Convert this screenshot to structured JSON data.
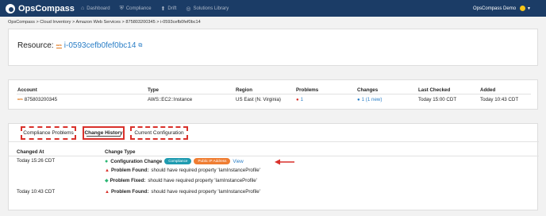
{
  "brand": "OpsCompass",
  "nav": [
    {
      "label": "Dashboard",
      "icon": "dashboard-icon",
      "glyph": "⌂"
    },
    {
      "label": "Compliance",
      "icon": "shield-icon",
      "glyph": "⛨"
    },
    {
      "label": "Drift",
      "icon": "drift-icon",
      "glyph": "⬆"
    },
    {
      "label": "Solutions Library",
      "icon": "library-icon",
      "glyph": "◎"
    }
  ],
  "user": {
    "name": "OpsCompass Demo",
    "status_color": "#f5c518"
  },
  "breadcrumb": "OpsCompass > Cloud Inventory > Amazon Web Services > 875803200345 > i-0593cefb0fef0bc14",
  "resource": {
    "prefix": "Resource:",
    "provider_badge": "aws",
    "id": "i-0593cefb0fef0bc14"
  },
  "info": {
    "headers": [
      "Account",
      "Type",
      "Region",
      "Problems",
      "Changes",
      "Last Checked",
      "Added"
    ],
    "account": "875803200345",
    "type": "AWS::EC2::Instance",
    "region": "US East (N. Virginia)",
    "problems": "1",
    "changes": "1 (1 new)",
    "last_checked": "Today 15:00 CDT",
    "added": "Today 10:43 CDT"
  },
  "tabs": [
    "Compliance Problems",
    "Change History",
    "Current Configuration"
  ],
  "active_tab": "Change History",
  "history": {
    "headers": [
      "Changed At",
      "Change Type"
    ],
    "rows": [
      {
        "time": "Today 15:26 CDT",
        "label": "Configuration Change",
        "badges": [
          "Compliance",
          "Public IP Address"
        ],
        "link": "View"
      },
      {
        "time": "",
        "label": "Problem Found:",
        "text": "should have required property 'IamInstanceProfile'"
      },
      {
        "time": "",
        "label": "Problem Fixed:",
        "text": "should have required property 'IamInstanceProfile'"
      },
      {
        "time": "Today 10:43 CDT",
        "label": "Problem Found:",
        "text": "should have required property 'IamInstanceProfile'"
      }
    ]
  },
  "colors": {
    "nav_bg": "#1b3c66",
    "link": "#2a7ec6",
    "annotation_red": "#d9312b",
    "badge_teal": "#1f9bb0",
    "badge_orange": "#ef7d32",
    "ok_green": "#2bb673"
  }
}
